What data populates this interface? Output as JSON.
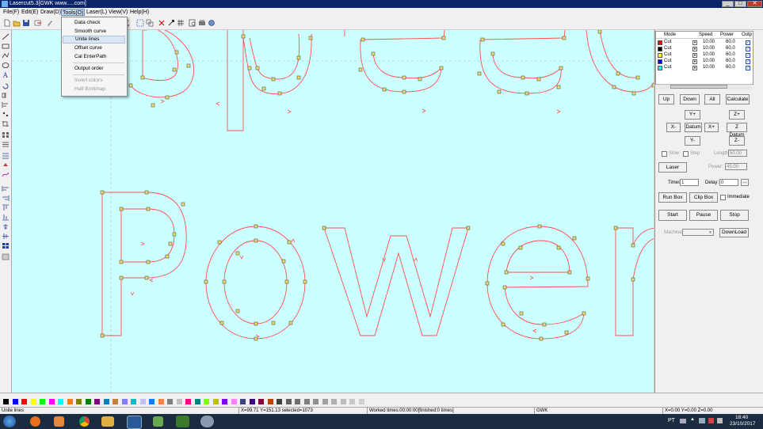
{
  "window": {
    "title": "Lasercut5.3[GWK www.....com]",
    "minimize": "_",
    "maximize": "□",
    "close": "✕"
  },
  "menubar": [
    "File(F)",
    "Edit(E)",
    "Draw(D)",
    "Tools(O)",
    "Laser(L)",
    "View(V)",
    "Help(H)"
  ],
  "tools_menu": {
    "items": [
      "Data check",
      "Smooth curve",
      "Unite lines",
      "Offset curve",
      "Cal EnterPath",
      "Output order",
      "Invert colors",
      "Half Bmitmap"
    ],
    "highlighted": "Unite lines",
    "disabled": [
      "Invert colors",
      "Half Bmitmap"
    ]
  },
  "canvas": {
    "background": "#ccffff",
    "paths": [
      "Speed",
      "Power"
    ],
    "path_color": "#ff4d4d",
    "node_color": "#f0e070"
  },
  "layers": {
    "headers": [
      "Mode",
      "Speed",
      "Power",
      "Outp"
    ],
    "rows": [
      {
        "color": "#ff0000",
        "mode": "Cut",
        "speed": "10.00",
        "power": "60.0"
      },
      {
        "color": "#000000",
        "mode": "Cut",
        "speed": "10.00",
        "power": "60.0"
      },
      {
        "color": "#ffff00",
        "mode": "Cut",
        "speed": "10.00",
        "power": "60.0"
      },
      {
        "color": "#0000ff",
        "mode": "Cut",
        "speed": "10.00",
        "power": "60.0"
      },
      {
        "color": "#00ffff",
        "mode": "Cut",
        "speed": "10.00",
        "power": "60.0"
      }
    ]
  },
  "panel": {
    "up": "Up",
    "down": "Down",
    "all": "All",
    "calculate": "Calculate",
    "yplus": "Y+",
    "zplus": "Z+",
    "xminus": "X-",
    "datum": "Datum",
    "xplus": "X+",
    "zdatum": "Z Datum",
    "yminus": "Y-",
    "zminus": "Z-",
    "slow": "Slow",
    "step": "Step",
    "length_label": "Length:",
    "length_value": "50.00",
    "laser": "Laser",
    "power_label": "Power:",
    "power_value": "45.00",
    "times_label": "Times:",
    "times_value": "1",
    "delay_label": "Delay:",
    "delay_value": "0",
    "delay_more": "...",
    "run_box": "Run Box",
    "clip_box": "Clip Box",
    "immediate": "Immediate",
    "start": "Start",
    "pause": "Pause",
    "stop": "Stop",
    "machine_label": "Machine:",
    "download": "DownLoad"
  },
  "palette": [
    "#000000",
    "#0000ff",
    "#ff0000",
    "#ffff00",
    "#00ff00",
    "#ff00ff",
    "#00ffff",
    "#ff8000",
    "#808000",
    "#008000",
    "#800080",
    "#0080c0",
    "#c08040",
    "#8080ff",
    "#00c0c0",
    "#c0c0ff",
    "#0080ff",
    "#ff8040",
    "#808080",
    "#c0c0c0",
    "#ff0080",
    "#008080",
    "#80ff00",
    "#c0c000",
    "#8000ff",
    "#ff80ff",
    "#404080",
    "#400080",
    "#800040",
    "#c04000",
    "#404040",
    "#606060",
    "#707070",
    "#808080",
    "#909090",
    "#a0a0a0",
    "#b0b0b0",
    "#bdbdbd",
    "#c8c8c8",
    "#d0d0d0"
  ],
  "status": {
    "action": "Unite lines",
    "coords": "X=99.71 Y=151.13 selected=1073",
    "worked": "Worked times:00:00:00[finished:0 times]",
    "brand": "GWK",
    "axes": "X=0.00 Y=0.00 Z=0.00"
  },
  "taskbar": {
    "lang": "PT",
    "time": "18:40",
    "date": "23/10/2017"
  }
}
